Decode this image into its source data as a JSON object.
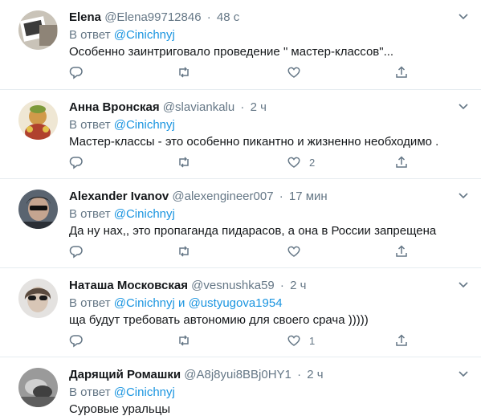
{
  "colors": {
    "link": "#1b95e0",
    "muted": "#657786",
    "text": "#14171a",
    "divider": "#e6ecf0"
  },
  "tweets": [
    {
      "name": "Elena",
      "handle": "@Elena99712846",
      "time": "48 с",
      "reply_prefix": "В ответ",
      "mentions": [
        "@Cinichnyj"
      ],
      "mention_joiner": "",
      "text": "Особенно заинтриговало проведение \" мастер-классов\"...",
      "likes": "",
      "avatar_icon": "avatar-photo"
    },
    {
      "name": "Анна Вронская",
      "handle": "@slaviankalu",
      "time": "2 ч",
      "reply_prefix": "В ответ",
      "mentions": [
        "@Cinichnyj"
      ],
      "mention_joiner": "",
      "text": "Мастер-классы - это особенно пикантно и жизненно необходимо .",
      "likes": "2",
      "avatar_icon": "avatar-photo"
    },
    {
      "name": "Alexander Ivanov",
      "handle": "@alexengineer007",
      "time": "17 мин",
      "reply_prefix": "В ответ",
      "mentions": [
        "@Cinichnyj"
      ],
      "mention_joiner": "",
      "text": "Да ну нах,, это пропаганда пидарасов, а она в России запрещена",
      "likes": "",
      "avatar_icon": "avatar-photo"
    },
    {
      "name": "Наташа Московская",
      "handle": "@vesnushka59",
      "time": "2 ч",
      "reply_prefix": "В ответ",
      "mentions": [
        "@Cinichnyj",
        "@ustyugova1954"
      ],
      "mention_joiner": "и",
      "text": "ща будут требовать автономию для своего срача )))))",
      "likes": "1",
      "avatar_icon": "avatar-photo"
    },
    {
      "name": "Дарящий Ромашки",
      "handle": "@A8j8yui8BBj0HY1",
      "time": "2 ч",
      "reply_prefix": "В ответ",
      "mentions": [
        "@Cinichnyj"
      ],
      "mention_joiner": "",
      "text": "Суровые уральцы",
      "likes": "",
      "avatar_icon": "avatar-photo"
    }
  ]
}
